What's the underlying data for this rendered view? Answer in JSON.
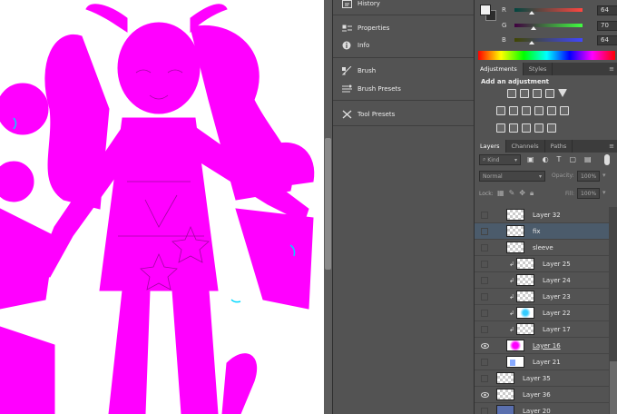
{
  "left_panel": {
    "items": [
      {
        "label": "History",
        "icon": "history-icon"
      },
      {
        "label": "Properties",
        "icon": "properties-icon"
      },
      {
        "label": "Info",
        "icon": "info-icon"
      },
      {
        "label": "Brush",
        "icon": "brush-icon"
      },
      {
        "label": "Brush Presets",
        "icon": "brush-presets-icon"
      },
      {
        "label": "Tool Presets",
        "icon": "tool-presets-icon"
      }
    ]
  },
  "color": {
    "r_label": "R",
    "g_label": "G",
    "b_label": "B",
    "r_value": "64",
    "g_value": "70",
    "b_value": "64",
    "foreground_color": "#404640"
  },
  "adjustments": {
    "tabs": [
      "Adjustments",
      "Styles"
    ],
    "heading": "Add an adjustment"
  },
  "layers_panel": {
    "tabs": [
      "Layers",
      "Channels",
      "Paths"
    ],
    "filter_kind": "Kind",
    "blend_mode": "Normal",
    "opacity_label": "Opacity:",
    "opacity_value": "100%",
    "lock_label": "Lock:",
    "fill_label": "Fill:",
    "fill_value": "100%",
    "layers": [
      {
        "name": "Layer 32",
        "visible": false,
        "clipped": false,
        "selected": false
      },
      {
        "name": "fix",
        "visible": false,
        "clipped": false,
        "selected": true
      },
      {
        "name": "sleeve",
        "visible": false,
        "clipped": false,
        "selected": false
      },
      {
        "name": "Layer 25",
        "visible": false,
        "clipped": true,
        "selected": false
      },
      {
        "name": "Layer 24",
        "visible": false,
        "clipped": true,
        "selected": false
      },
      {
        "name": "Layer 23",
        "visible": false,
        "clipped": true,
        "selected": false
      },
      {
        "name": "Layer 22",
        "visible": false,
        "clipped": true,
        "selected": false
      },
      {
        "name": "Layer 17",
        "visible": false,
        "clipped": true,
        "selected": false
      },
      {
        "name": "Layer 16",
        "visible": true,
        "clipped": false,
        "selected": false
      },
      {
        "name": "Layer 21",
        "visible": false,
        "clipped": false,
        "selected": false
      },
      {
        "name": "Layer 35",
        "visible": false,
        "clipped": false,
        "selected": false
      },
      {
        "name": "Layer 36",
        "visible": true,
        "clipped": false,
        "selected": false
      },
      {
        "name": "Layer 20",
        "visible": false,
        "clipped": false,
        "selected": false
      }
    ]
  },
  "colors": {
    "canvas_art": "#ff00ff",
    "panel_bg": "#535353",
    "selected_row": "#4b5b6b"
  }
}
